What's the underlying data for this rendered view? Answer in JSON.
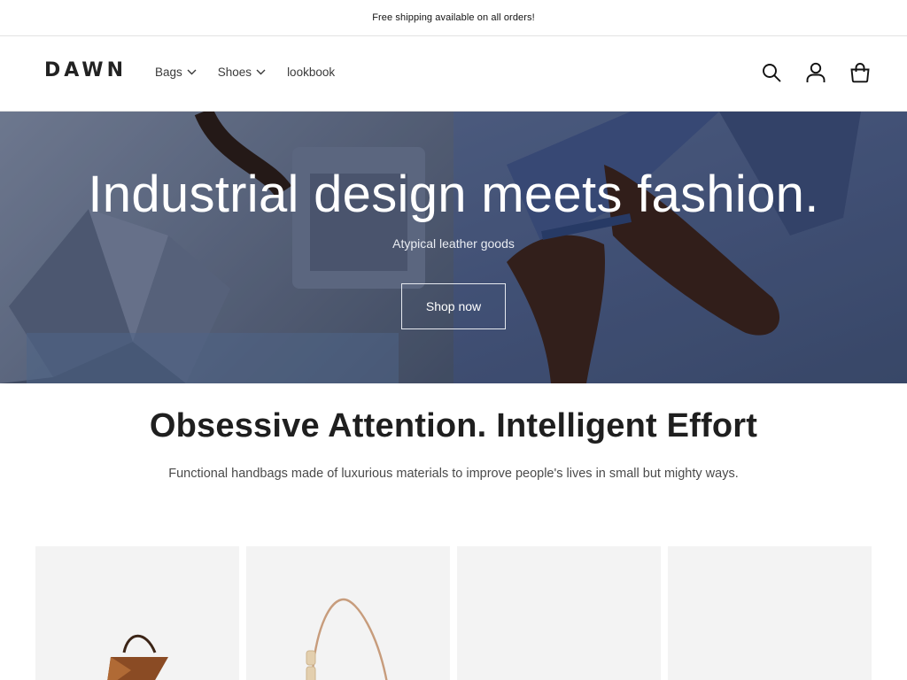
{
  "announcement": {
    "text": "Free shipping available on all orders!"
  },
  "header": {
    "logo": "DAWN",
    "nav": [
      {
        "label": "Bags",
        "has_dropdown": true
      },
      {
        "label": "Shoes",
        "has_dropdown": true
      },
      {
        "label": "lookbook",
        "has_dropdown": false
      }
    ],
    "icons": [
      "search-icon",
      "account-icon",
      "cart-icon"
    ]
  },
  "hero": {
    "title": "Industrial design meets fashion.",
    "subtitle": "Atypical leather goods",
    "button_label": "Shop now"
  },
  "feature": {
    "title": "Obsessive Attention. Intelligent Effort",
    "subtitle": "Functional handbags made of luxurious materials to improve people's lives in small but mighty ways."
  },
  "products": [
    {
      "image": "brown-leather-bag"
    },
    {
      "image": "tan-shoulder-bag"
    },
    {
      "image": ""
    },
    {
      "image": ""
    }
  ],
  "colors": {
    "text": "#121212",
    "hero_bg": "#56647e",
    "card_bg": "#f3f3f3",
    "border": "#e2e2e2"
  }
}
